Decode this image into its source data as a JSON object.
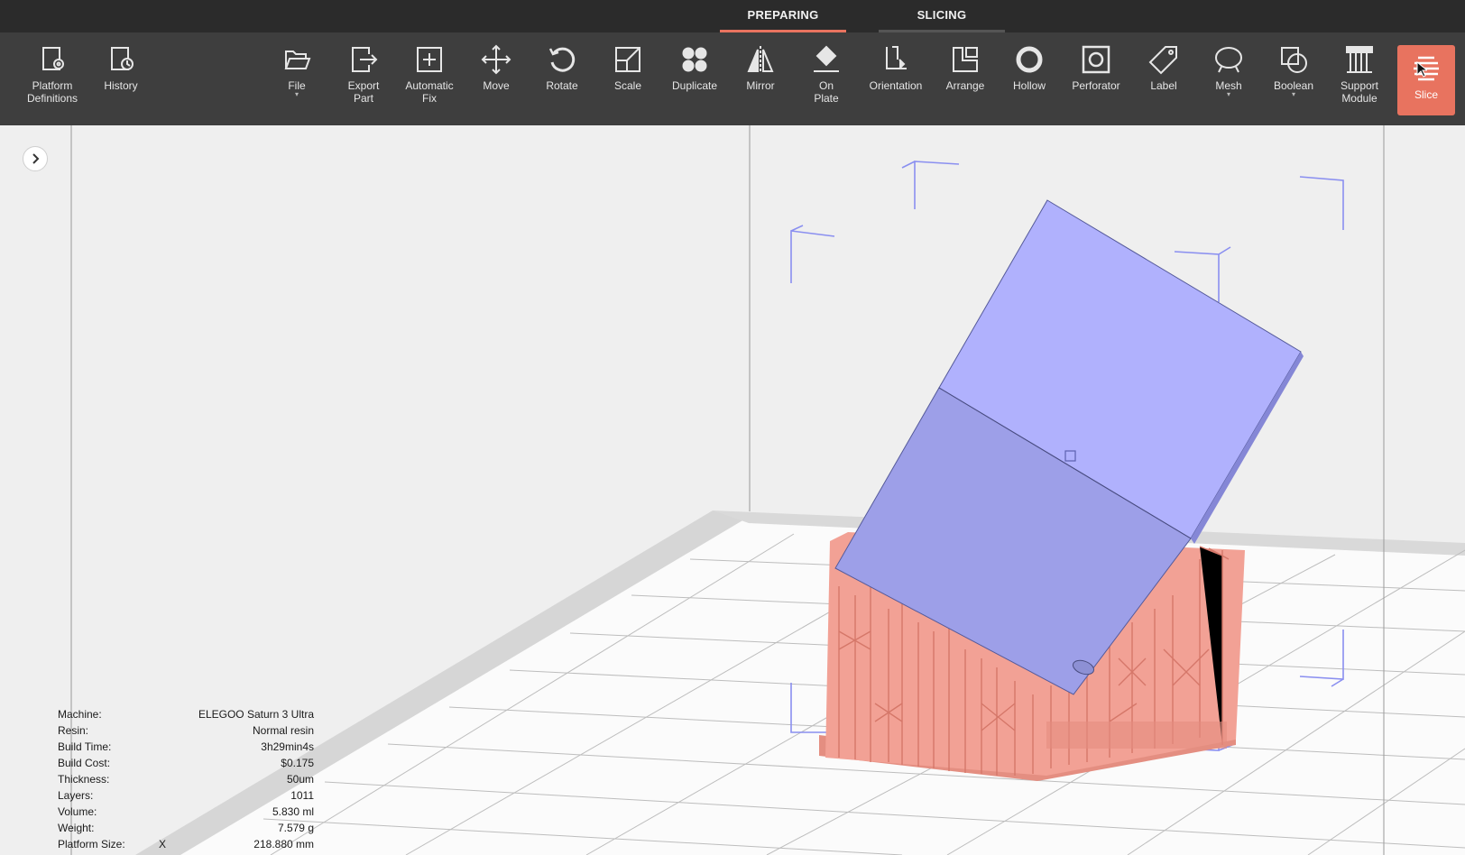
{
  "mode_tabs": {
    "preparing": "PREPARING",
    "slicing": "SLICING"
  },
  "toolbar": {
    "platform_definitions": "Platform\nDefinitions",
    "history": "History",
    "file": "File",
    "export_part": "Export\nPart",
    "automatic_fix": "Automatic\nFix",
    "move": "Move",
    "rotate": "Rotate",
    "scale": "Scale",
    "duplicate": "Duplicate",
    "mirror": "Mirror",
    "on_plate": "On\nPlate",
    "orientation": "Orientation",
    "arrange": "Arrange",
    "hollow": "Hollow",
    "perforator": "Perforator",
    "label": "Label",
    "mesh": "Mesh",
    "boolean": "Boolean",
    "support_module": "Support\nModule",
    "slice": "Slice"
  },
  "colors": {
    "accent": "#e8735f",
    "model": "#aeaffc",
    "supports": "#f2a195",
    "toolbar": "#3e3e3e",
    "topbar": "#2b2b2b"
  },
  "info": {
    "machine_label": "Machine:",
    "machine": "ELEGOO Saturn 3 Ultra",
    "resin_label": "Resin:",
    "resin": "Normal resin",
    "build_time_label": "Build Time:",
    "build_time": "3h29min4s",
    "build_cost_label": "Build Cost:",
    "build_cost": "$0.175",
    "thickness_label": "Thickness:",
    "thickness": "50um",
    "layers_label": "Layers:",
    "layers": "1011",
    "volume_label": "Volume:",
    "volume": "5.830 ml",
    "weight_label": "Weight:",
    "weight": "7.579 g",
    "platform_size_label": "Platform Size:",
    "platform_axis": "X",
    "platform_size": "218.880 mm"
  }
}
